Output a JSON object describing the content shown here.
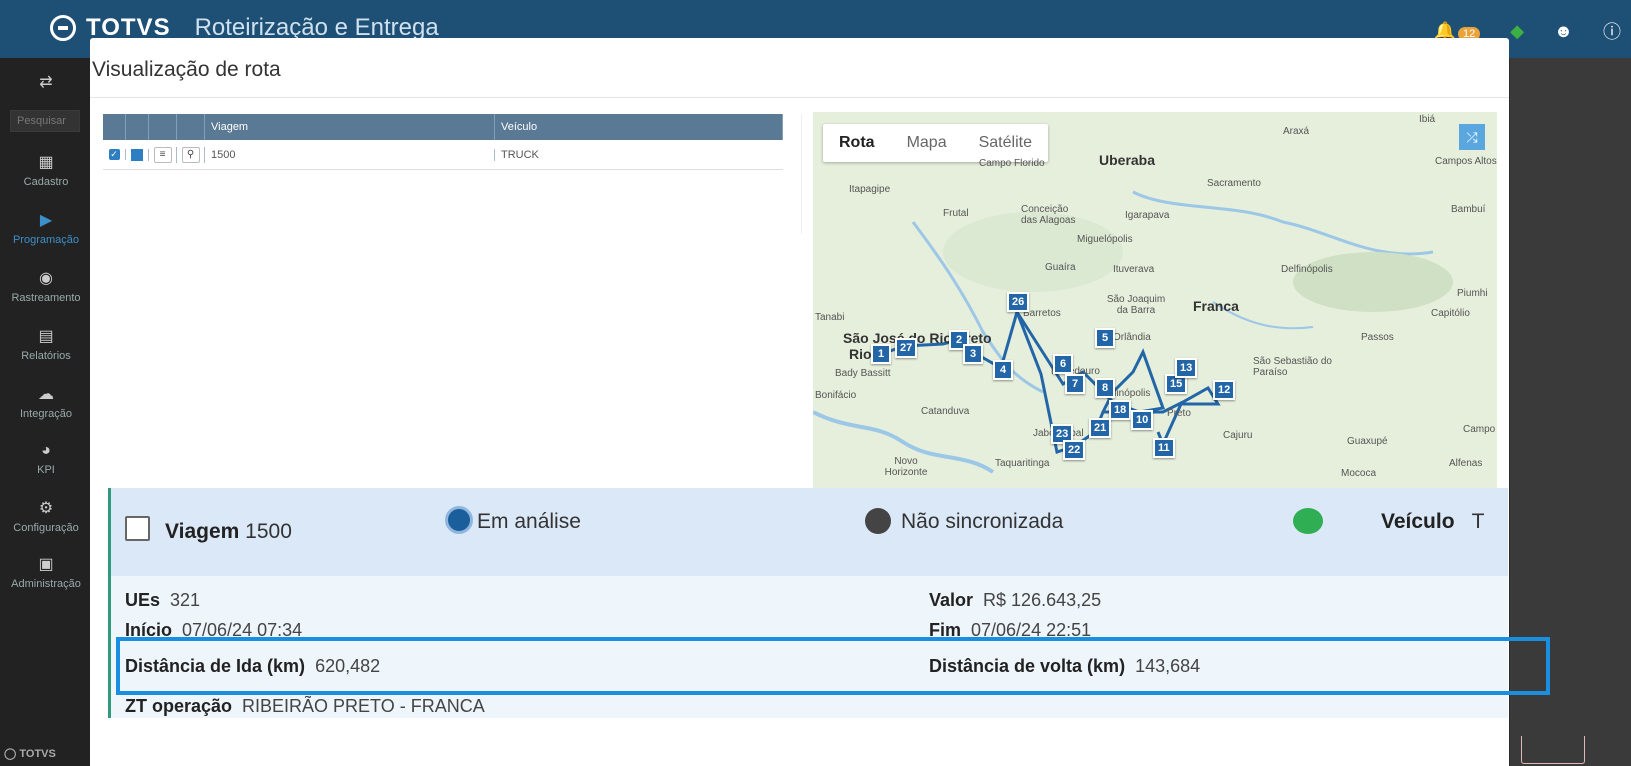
{
  "app": {
    "brand": "TOTVS",
    "title": "Roteirização e Entrega",
    "notifications": "12"
  },
  "sidebar": {
    "search_placeholder": "Pesquisar",
    "items": [
      {
        "label": "Cadastro",
        "icon": "list-icon"
      },
      {
        "label": "Programação",
        "icon": "play-icon"
      },
      {
        "label": "Rastreamento",
        "icon": "pin-icon"
      },
      {
        "label": "Relatórios",
        "icon": "report-icon"
      },
      {
        "label": "Integração",
        "icon": "cloud-icon"
      },
      {
        "label": "KPI",
        "icon": "chart-icon"
      },
      {
        "label": "Configuração",
        "icon": "gear-icon"
      },
      {
        "label": "Administração",
        "icon": "briefcase-icon"
      }
    ],
    "footer": "TOTVS"
  },
  "modal": {
    "title": "Visualização de rota",
    "grid": {
      "headers": [
        "",
        "",
        "",
        "",
        "Viagem",
        "Veículo"
      ],
      "rows": [
        {
          "viagem": "1500",
          "veiculo": "TRUCK"
        }
      ]
    },
    "map": {
      "tabs": [
        "Rota",
        "Mapa",
        "Satélite"
      ],
      "places": [
        "Uberaba",
        "Franca",
        "Araxá",
        "Sacramento",
        "Campos Altos",
        "Bambuí",
        "Campo Florido",
        "Itapagipe",
        "Frutal",
        "Conceição das Alagoas",
        "Igarapava",
        "Miguelópolis",
        "Guaíra",
        "Ituverava",
        "Delfinópolis",
        "Piumhi",
        "São Joaquim da Barra",
        "Orlândia",
        "Capitólio",
        "Passos",
        "São Sebastião do Paraíso",
        "Tanabi",
        "São José do Rio Preto",
        "Bady Bassitt",
        "Bonifácio",
        "Catanduva",
        "Jardinópolis",
        "Cajuru",
        "Guaxupé",
        "Campo",
        "Alfenas",
        "Mococa",
        "Novo Horizonte",
        "Taquaritinga",
        "Barretos",
        "Bebedouro",
        "Jaboticabal",
        "Preto",
        "Ibiá",
        "Rio"
      ],
      "stops": [
        "1",
        "27",
        "2",
        "3",
        "4",
        "26",
        "6",
        "7",
        "5",
        "8",
        "18",
        "10",
        "21",
        "23",
        "22",
        "11",
        "12",
        "15",
        "13"
      ]
    }
  },
  "summary": {
    "trip_label": "Viagem",
    "trip_value": "1500",
    "status": "Em análise",
    "sync": "Não sincronizada",
    "vehicle_label": "Veículo",
    "vehicle_value": "T",
    "ues_label": "UEs",
    "ues_value": "321",
    "valor_label": "Valor",
    "valor_value": "R$ 126.643,25",
    "inicio_label": "Início",
    "inicio_value": "07/06/24 07:34",
    "fim_label": "Fim",
    "fim_value": "07/06/24 22:51",
    "ida_label": "Distância de Ida (km)",
    "ida_value": "620,482",
    "volta_label": "Distância de volta (km)",
    "volta_value": "143,684",
    "zt_label": "ZT operação",
    "zt_value": "RIBEIRÃO PRETO - FRANCA"
  },
  "colors": {
    "topbar": "#1e4f74",
    "grid_header": "#5a7994",
    "route": "#2366a8",
    "highlight": "#1a8fe0"
  }
}
